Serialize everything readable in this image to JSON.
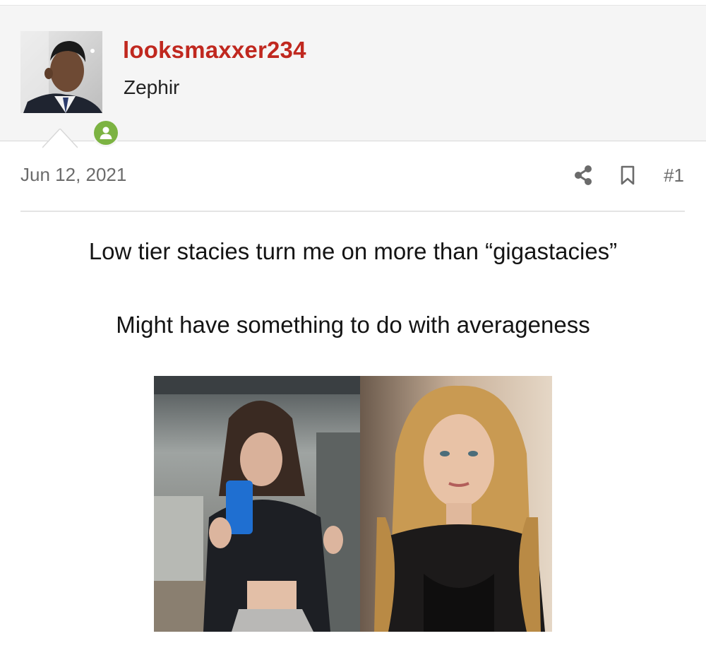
{
  "user": {
    "username": "looksmaxxer234",
    "title": "Zephir",
    "avatar_icon": "user-avatar-photo",
    "online_icon": "online-status-icon",
    "online_color": "#7cb342"
  },
  "post": {
    "date": "Jun 12, 2021",
    "number": "#1",
    "actions": [
      "share-icon",
      "bookmark-icon"
    ],
    "body": [
      "Low tier stacies turn me on more than “gigastacies”",
      "Might have something to do with averageness"
    ],
    "attachment_icon": "post-image"
  },
  "colors": {
    "username": "#c0281f",
    "header_bg": "#f5f5f5",
    "meta_text": "#6b6b6b"
  }
}
